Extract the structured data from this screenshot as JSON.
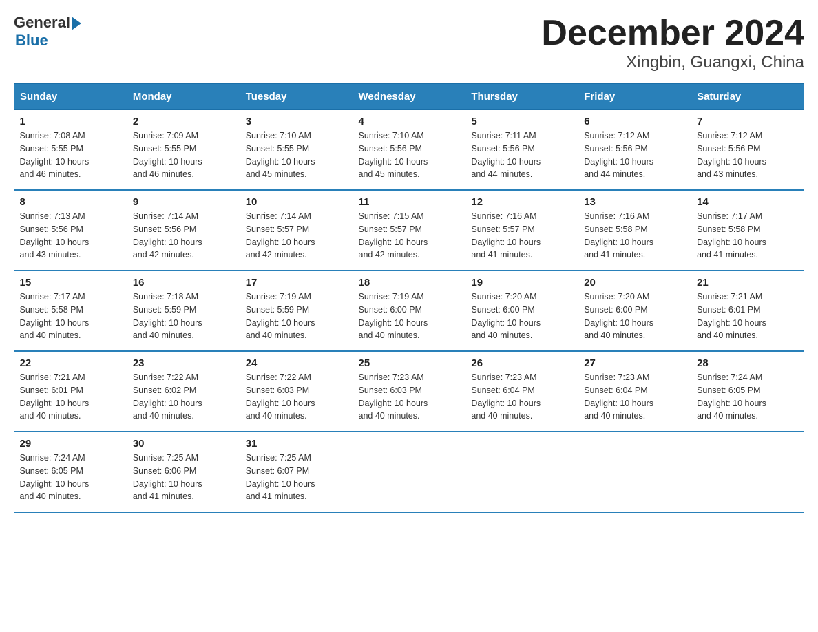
{
  "logo": {
    "general": "General",
    "blue": "Blue"
  },
  "title": "December 2024",
  "subtitle": "Xingbin, Guangxi, China",
  "days_of_week": [
    "Sunday",
    "Monday",
    "Tuesday",
    "Wednesday",
    "Thursday",
    "Friday",
    "Saturday"
  ],
  "weeks": [
    [
      {
        "day": "1",
        "sunrise": "7:08 AM",
        "sunset": "5:55 PM",
        "daylight": "10 hours and 46 minutes."
      },
      {
        "day": "2",
        "sunrise": "7:09 AM",
        "sunset": "5:55 PM",
        "daylight": "10 hours and 46 minutes."
      },
      {
        "day": "3",
        "sunrise": "7:10 AM",
        "sunset": "5:55 PM",
        "daylight": "10 hours and 45 minutes."
      },
      {
        "day": "4",
        "sunrise": "7:10 AM",
        "sunset": "5:56 PM",
        "daylight": "10 hours and 45 minutes."
      },
      {
        "day": "5",
        "sunrise": "7:11 AM",
        "sunset": "5:56 PM",
        "daylight": "10 hours and 44 minutes."
      },
      {
        "day": "6",
        "sunrise": "7:12 AM",
        "sunset": "5:56 PM",
        "daylight": "10 hours and 44 minutes."
      },
      {
        "day": "7",
        "sunrise": "7:12 AM",
        "sunset": "5:56 PM",
        "daylight": "10 hours and 43 minutes."
      }
    ],
    [
      {
        "day": "8",
        "sunrise": "7:13 AM",
        "sunset": "5:56 PM",
        "daylight": "10 hours and 43 minutes."
      },
      {
        "day": "9",
        "sunrise": "7:14 AM",
        "sunset": "5:56 PM",
        "daylight": "10 hours and 42 minutes."
      },
      {
        "day": "10",
        "sunrise": "7:14 AM",
        "sunset": "5:57 PM",
        "daylight": "10 hours and 42 minutes."
      },
      {
        "day": "11",
        "sunrise": "7:15 AM",
        "sunset": "5:57 PM",
        "daylight": "10 hours and 42 minutes."
      },
      {
        "day": "12",
        "sunrise": "7:16 AM",
        "sunset": "5:57 PM",
        "daylight": "10 hours and 41 minutes."
      },
      {
        "day": "13",
        "sunrise": "7:16 AM",
        "sunset": "5:58 PM",
        "daylight": "10 hours and 41 minutes."
      },
      {
        "day": "14",
        "sunrise": "7:17 AM",
        "sunset": "5:58 PM",
        "daylight": "10 hours and 41 minutes."
      }
    ],
    [
      {
        "day": "15",
        "sunrise": "7:17 AM",
        "sunset": "5:58 PM",
        "daylight": "10 hours and 40 minutes."
      },
      {
        "day": "16",
        "sunrise": "7:18 AM",
        "sunset": "5:59 PM",
        "daylight": "10 hours and 40 minutes."
      },
      {
        "day": "17",
        "sunrise": "7:19 AM",
        "sunset": "5:59 PM",
        "daylight": "10 hours and 40 minutes."
      },
      {
        "day": "18",
        "sunrise": "7:19 AM",
        "sunset": "6:00 PM",
        "daylight": "10 hours and 40 minutes."
      },
      {
        "day": "19",
        "sunrise": "7:20 AM",
        "sunset": "6:00 PM",
        "daylight": "10 hours and 40 minutes."
      },
      {
        "day": "20",
        "sunrise": "7:20 AM",
        "sunset": "6:00 PM",
        "daylight": "10 hours and 40 minutes."
      },
      {
        "day": "21",
        "sunrise": "7:21 AM",
        "sunset": "6:01 PM",
        "daylight": "10 hours and 40 minutes."
      }
    ],
    [
      {
        "day": "22",
        "sunrise": "7:21 AM",
        "sunset": "6:01 PM",
        "daylight": "10 hours and 40 minutes."
      },
      {
        "day": "23",
        "sunrise": "7:22 AM",
        "sunset": "6:02 PM",
        "daylight": "10 hours and 40 minutes."
      },
      {
        "day": "24",
        "sunrise": "7:22 AM",
        "sunset": "6:03 PM",
        "daylight": "10 hours and 40 minutes."
      },
      {
        "day": "25",
        "sunrise": "7:23 AM",
        "sunset": "6:03 PM",
        "daylight": "10 hours and 40 minutes."
      },
      {
        "day": "26",
        "sunrise": "7:23 AM",
        "sunset": "6:04 PM",
        "daylight": "10 hours and 40 minutes."
      },
      {
        "day": "27",
        "sunrise": "7:23 AM",
        "sunset": "6:04 PM",
        "daylight": "10 hours and 40 minutes."
      },
      {
        "day": "28",
        "sunrise": "7:24 AM",
        "sunset": "6:05 PM",
        "daylight": "10 hours and 40 minutes."
      }
    ],
    [
      {
        "day": "29",
        "sunrise": "7:24 AM",
        "sunset": "6:05 PM",
        "daylight": "10 hours and 40 minutes."
      },
      {
        "day": "30",
        "sunrise": "7:25 AM",
        "sunset": "6:06 PM",
        "daylight": "10 hours and 41 minutes."
      },
      {
        "day": "31",
        "sunrise": "7:25 AM",
        "sunset": "6:07 PM",
        "daylight": "10 hours and 41 minutes."
      },
      null,
      null,
      null,
      null
    ]
  ],
  "labels": {
    "sunrise": "Sunrise: ",
    "sunset": "Sunset: ",
    "daylight": "Daylight: "
  }
}
